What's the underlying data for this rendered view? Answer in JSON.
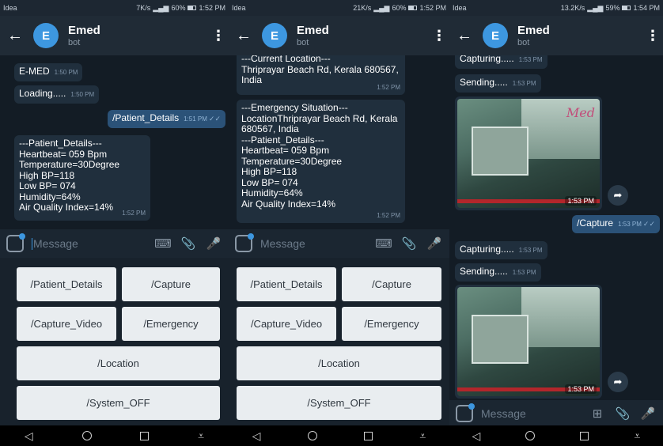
{
  "chat": {
    "name": "Emed",
    "subtitle": "bot",
    "avatar_letter": "E"
  },
  "accent_color": "#3d97e0",
  "input_placeholder": "Message",
  "keyboard_buttons": {
    "patient_details": "/Patient_Details",
    "capture": "/Capture",
    "capture_video": "/Capture_Video",
    "emergency": "/Emergency",
    "location": "/Location",
    "system_off": "/System_OFF"
  },
  "screens": [
    {
      "status": {
        "carrier": "Idea",
        "speed": "7K/s",
        "battery": "60%",
        "time": "1:52 PM"
      },
      "messages": [
        {
          "text": "E-MED",
          "time": "1:50 PM"
        },
        {
          "text": "Loading.....",
          "time": "1:50 PM"
        },
        {
          "text": "/Patient_Details",
          "time": "1:51 PM",
          "ticks": "✓✓"
        },
        {
          "text": "---Patient_Details---\nHeartbeat= 059 Bpm\nTemperature=30Degree\nHigh BP=118\nLow BP= 074\nHumidity=64%\nAir Quality Index=14%",
          "time": "1:52 PM"
        }
      ]
    },
    {
      "status": {
        "carrier": "Idea",
        "speed": "21K/s",
        "battery": "60%",
        "time": "1:52 PM"
      },
      "messages": [
        {
          "text": "---Current Location---\nThriprayar Beach Rd, Kerala 680567,\nIndia",
          "time": "1:52 PM"
        },
        {
          "text": "---Emergency Situation---\nLocationThriprayar Beach Rd, Kerala\n680567, India\n---Patient_Details---\nHeartbeat= 059 Bpm\nTemperature=30Degree\nHigh BP=118\nLow BP= 074\nHumidity=64%\nAir Quality Index=14%",
          "time": "1:52 PM"
        }
      ]
    },
    {
      "status": {
        "carrier": "Idea",
        "speed": "13.2K/s",
        "battery": "59%",
        "time": "1:54 PM"
      },
      "messages": [
        {
          "text": "Capturing.....",
          "time": "1:53 PM"
        },
        {
          "text": "Sending.....",
          "time": "1:53 PM"
        },
        {
          "photo_time": "1:53 PM",
          "photo_logo": "Med"
        },
        {
          "text": "/Capture",
          "time": "1:53 PM",
          "ticks": "✓✓"
        },
        {
          "text": "Capturing.....",
          "time": "1:53 PM"
        },
        {
          "text": "Sending.....",
          "time": "1:53 PM"
        },
        {
          "photo_time": "1:53 PM"
        }
      ]
    }
  ]
}
